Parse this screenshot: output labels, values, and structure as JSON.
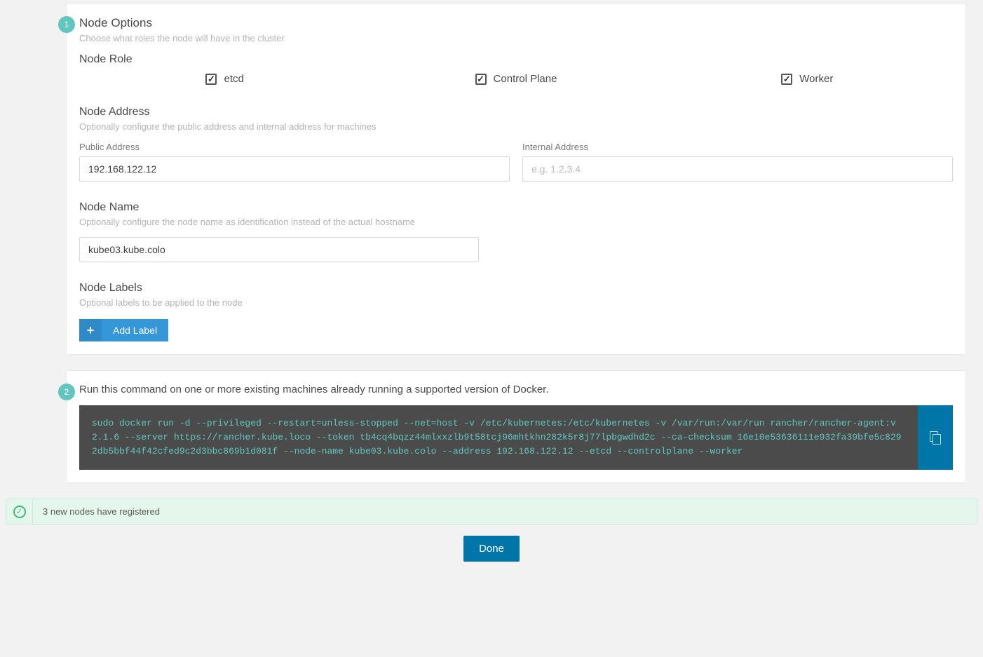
{
  "step1": {
    "badge": "1",
    "title": "Node Options",
    "subtitle": "Choose what roles the node will have in the cluster",
    "roleSection": {
      "label": "Node Role",
      "roles": [
        {
          "name": "etcd",
          "checked": true
        },
        {
          "name": "Control Plane",
          "checked": true
        },
        {
          "name": "Worker",
          "checked": true
        }
      ]
    },
    "addressSection": {
      "title": "Node Address",
      "subtitle": "Optionally configure the public address and internal address for machines",
      "public": {
        "label": "Public Address",
        "value": "192.168.122.12"
      },
      "internal": {
        "label": "Internal Address",
        "value": "",
        "placeholder": "e.g. 1.2.3.4"
      }
    },
    "nameSection": {
      "title": "Node Name",
      "subtitle": "Optionally configure the node name as identification instead of the actual hostname",
      "value": "kube03.kube.colo"
    },
    "labelsSection": {
      "title": "Node Labels",
      "subtitle": "Optional labels to be applied to the node",
      "addButton": "Add Label"
    }
  },
  "step2": {
    "badge": "2",
    "instruction": "Run this command on one or more existing machines already running a supported version of Docker.",
    "command": "sudo docker run -d --privileged --restart=unless-stopped --net=host -v /etc/kubernetes:/etc/kubernetes -v /var/run:/var/run rancher/rancher-agent:v2.1.6 --server https://rancher.kube.loco --token tb4cq4bqzz44mlxxzlb9t58tcj96mhtkhn282k5r8j77lpbgwdhd2c --ca-checksum 16e10e53636111e932fa39bfe5c8292db5bbf44f42cfed9c2d3bbc869b1d081f --node-name kube03.kube.colo --address 192.168.122.12 --etcd --controlplane --worker"
  },
  "status": {
    "message": "3 new nodes have registered"
  },
  "doneButton": "Done"
}
